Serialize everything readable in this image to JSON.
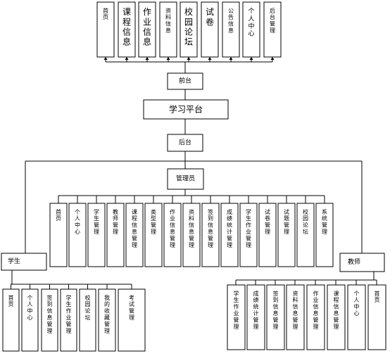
{
  "center": "学习平台",
  "frontend": {
    "label": "前台",
    "items": [
      "首页",
      "课程信息",
      "作业信息",
      "资料信息",
      "校园论坛",
      "试卷",
      "公告信息",
      "个人中心",
      "后台管理"
    ]
  },
  "backend": {
    "label": "后台",
    "admin": {
      "label": "管理员",
      "items": [
        "首页",
        "个人中心",
        "学生管理",
        "教师管理",
        "课程信息管理",
        "类型管理",
        "作业信息管理",
        "资料信息管理",
        "签到信息管理",
        "成绩统计管理",
        "学生作业管理",
        "试卷管理",
        "试题管理",
        "校园论坛",
        "系统管理"
      ]
    },
    "student": {
      "label": "学生",
      "items": [
        "首页",
        "个人中心",
        "签到信息管理",
        "学生作业管理",
        "校园论坛",
        "我的收藏管理",
        "考试管理"
      ]
    },
    "teacher": {
      "label": "教师",
      "items": [
        "学生作业管理",
        "成绩统计管理",
        "签到信息管理",
        "资料信息管理",
        "作业信息管理",
        "课程信息管理",
        "个人中心",
        "首页"
      ]
    }
  }
}
